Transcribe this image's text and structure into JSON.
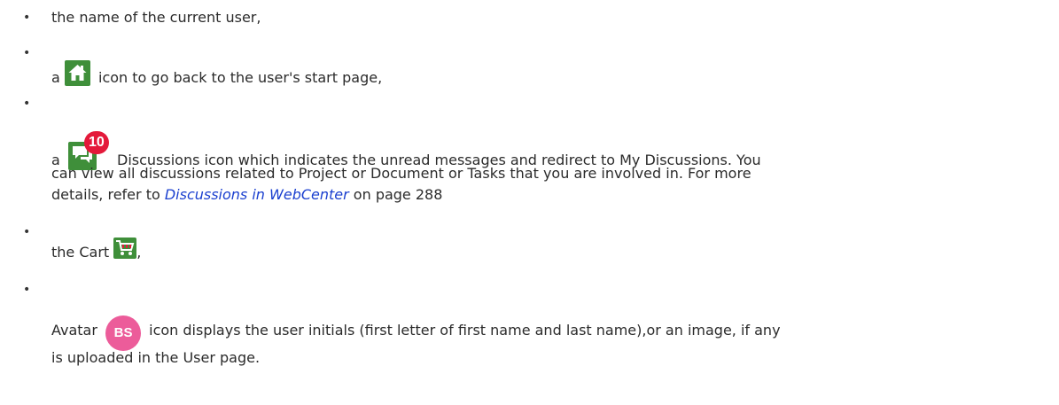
{
  "items": [
    {
      "text": "the name of the current user,"
    },
    {
      "prefix": "a",
      "icon": "home-icon",
      "suffix": "icon to go back to the user's start page,"
    },
    {
      "prefix": "a",
      "icon": "discussions-icon",
      "badge": "10",
      "line1": "Discussions icon which indicates the unread messages and redirect to My Discussions. You",
      "line2": "can view all discussions related to Project or Document or Tasks that you are involved in. For more",
      "line3_pre": "details, refer to",
      "link": "Discussions in WebCenter",
      "line3_post": "on page 288"
    },
    {
      "prefix": "the Cart",
      "icon": "cart-icon",
      "suffix": ","
    },
    {
      "prefix": "Avatar",
      "avatar_initials": "BS",
      "line1": "icon displays the user initials (first letter of first name and last name),or an image, if any",
      "line2": "is uploaded in the User page."
    }
  ],
  "colors": {
    "icon_green": "#3f8f3a",
    "badge_red": "#e4193a",
    "avatar_pink": "#ec5c9a",
    "link_blue": "#1a3fcf"
  }
}
